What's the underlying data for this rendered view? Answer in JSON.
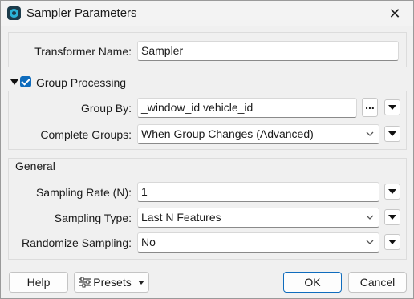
{
  "window": {
    "title": "Sampler Parameters",
    "icon": "sampler-app-icon",
    "close_glyph": "✕"
  },
  "transformer": {
    "label": "Transformer Name:",
    "value": "Sampler"
  },
  "group_processing": {
    "title": "Group Processing",
    "enabled": true,
    "group_by": {
      "label": "Group By:",
      "value": "_window_id vehicle_id",
      "ellipsis": "..."
    },
    "complete_groups": {
      "label": "Complete Groups:",
      "value": "When Group Changes (Advanced)"
    }
  },
  "general": {
    "title": "General",
    "sampling_rate": {
      "label": "Sampling Rate (N):",
      "value": "1"
    },
    "sampling_type": {
      "label": "Sampling Type:",
      "value": "Last N Features"
    },
    "randomize": {
      "label": "Randomize Sampling:",
      "value": "No"
    }
  },
  "footer": {
    "help": "Help",
    "presets": "Presets",
    "ok": "OK",
    "cancel": "Cancel"
  },
  "colors": {
    "accent": "#0f6cbd"
  }
}
